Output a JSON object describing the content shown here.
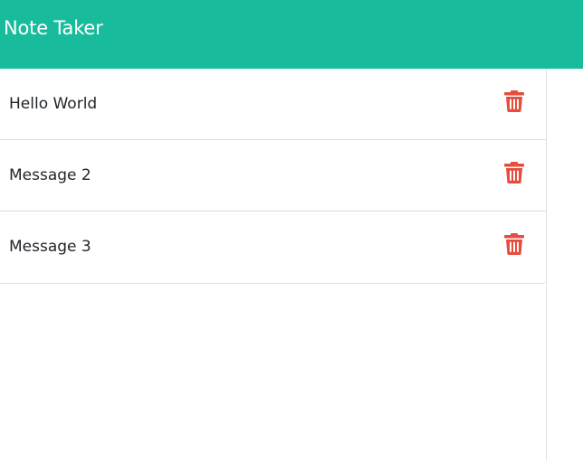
{
  "navbar": {
    "brand": "Note Taker"
  },
  "notes": [
    {
      "title": "Hello World",
      "action_icon": "trash-icon"
    },
    {
      "title": "Message 2",
      "action_icon": "trash-icon"
    },
    {
      "title": "Message 3",
      "action_icon": "trash-icon"
    }
  ],
  "colors": {
    "navbar_bg": "#18bc9c",
    "brand_text": "#ffffff",
    "delete_icon": "#e74c3c",
    "note_text": "#212529"
  }
}
